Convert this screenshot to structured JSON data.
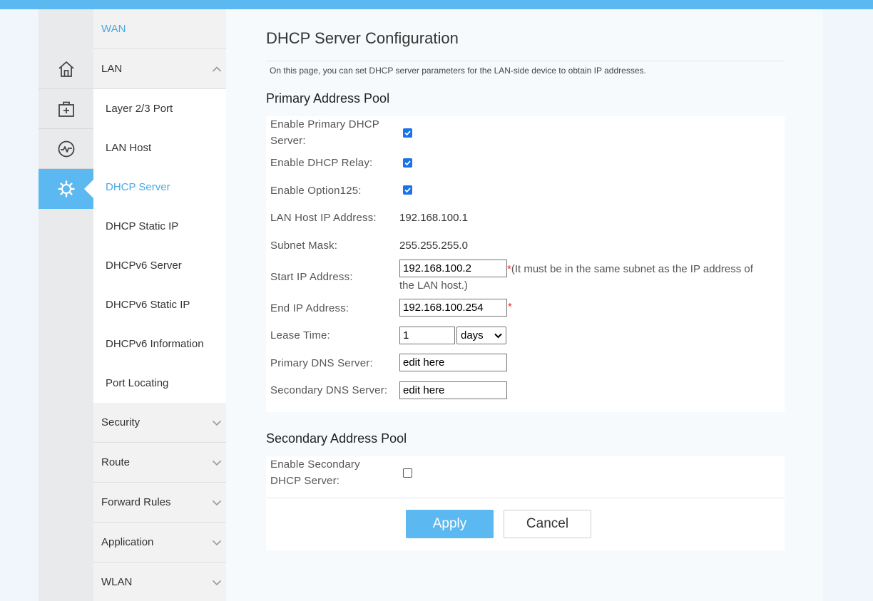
{
  "menu": {
    "wan": "WAN",
    "lan": "LAN",
    "lan_items": [
      "Layer 2/3 Port",
      "LAN Host",
      "DHCP Server",
      "DHCP Static IP",
      "DHCPv6 Server",
      "DHCPv6 Static IP",
      "DHCPv6 Information",
      "Port Locating"
    ],
    "active_item": "DHCP Server",
    "groups": [
      "Security",
      "Route",
      "Forward Rules",
      "Application",
      "WLAN"
    ]
  },
  "page": {
    "title": "DHCP Server Configuration",
    "description": "On this page, you can set DHCP server parameters for the LAN-side device to obtain IP addresses."
  },
  "primary": {
    "title": "Primary Address Pool",
    "enable_server_label_1": "Enable Primary DHCP",
    "enable_server_label_2": "Server:",
    "enable_server": true,
    "relay_label": "Enable DHCP Relay:",
    "relay": true,
    "option125_label": "Enable Option125:",
    "option125": true,
    "lan_ip_label": "LAN Host IP Address:",
    "lan_ip": "192.168.100.1",
    "mask_label": "Subnet Mask:",
    "mask": "255.255.255.0",
    "start_label": "Start IP Address:",
    "start_ip": "192.168.100.2",
    "start_note_1": "(It must be in the same subnet as the IP address of",
    "start_note_2": "the LAN host.)",
    "end_label": "End IP Address:",
    "end_ip": "192.168.100.254",
    "required_mark": "*",
    "lease_label": "Lease Time:",
    "lease_value": "1",
    "lease_unit": "days",
    "dns1_label": "Primary DNS Server:",
    "dns1": "edit here",
    "dns2_label": "Secondary DNS Server:",
    "dns2": "edit here"
  },
  "secondary": {
    "title": "Secondary Address Pool",
    "enable_label_1": "Enable Secondary",
    "enable_label_2": "DHCP Server:",
    "enable": false
  },
  "buttons": {
    "apply": "Apply",
    "cancel": "Cancel"
  },
  "colors": {
    "accent": "#5bb8f1",
    "active_text": "#4aa9e6",
    "checkbox": "#1a73e8",
    "required": "#e0312f"
  }
}
